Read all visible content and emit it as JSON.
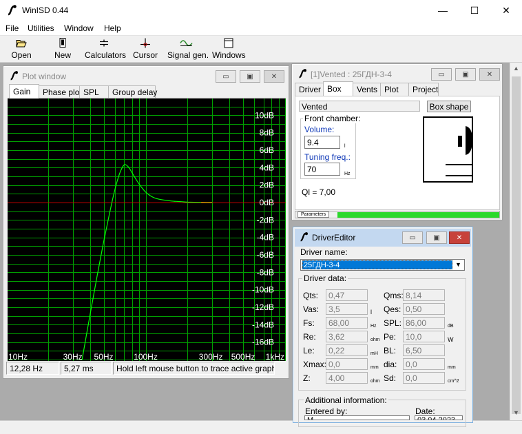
{
  "app": {
    "title": "WinISD 0.44",
    "controls": {
      "minimize": "—",
      "maximize": "☐",
      "close": "✕"
    }
  },
  "menu": [
    "File",
    "Utilities",
    "Window",
    "Help"
  ],
  "toolbar": {
    "open": "Open",
    "new": "New",
    "calculators": "Calculators",
    "cursor": "Cursor",
    "signal_gen": "Signal gen.",
    "windows": "Windows"
  },
  "plot_window": {
    "title": "Plot window",
    "tabs": [
      "Gain",
      "Phase plot",
      "SPL",
      "Group delay"
    ],
    "selected_tab": "Gain",
    "status": {
      "frequency": "12,28 Hz",
      "time": "5,27 ms",
      "hint": "Hold left mouse button to trace active graph"
    }
  },
  "chart_data": {
    "type": "line",
    "title": "",
    "xlabel": "",
    "ylabel": "",
    "x_scale": "log",
    "xlim": [
      10,
      1000
    ],
    "ylim": [
      -18,
      12
    ],
    "x_ticks": [
      {
        "value": 10,
        "label": "10Hz"
      },
      {
        "value": 30,
        "label": "30Hz"
      },
      {
        "value": 50,
        "label": "50Hz"
      },
      {
        "value": 100,
        "label": "100Hz"
      },
      {
        "value": 300,
        "label": "300Hz"
      },
      {
        "value": 500,
        "label": "500Hz"
      },
      {
        "value": 1000,
        "label": "1kHz"
      }
    ],
    "y_ticks": [
      {
        "value": 10,
        "label": "10dB"
      },
      {
        "value": 8,
        "label": "8dB"
      },
      {
        "value": 6,
        "label": "6dB"
      },
      {
        "value": 4,
        "label": "4dB"
      },
      {
        "value": 2,
        "label": "2dB"
      },
      {
        "value": 0,
        "label": "0dB"
      },
      {
        "value": -2,
        "label": "-2dB"
      },
      {
        "value": -4,
        "label": "-4dB"
      },
      {
        "value": -6,
        "label": "-6dB"
      },
      {
        "value": -8,
        "label": "-8dB"
      },
      {
        "value": -10,
        "label": "-10dB"
      },
      {
        "value": -12,
        "label": "-12dB"
      },
      {
        "value": -14,
        "label": "-14dB"
      },
      {
        "value": -16,
        "label": "-16dB"
      }
    ],
    "grid": true,
    "reference_line": 0,
    "colors": {
      "background": "#000000",
      "grid": "#00a000",
      "curve": "#00ff00",
      "curve_tail": "#c8c800",
      "reference": "#cc0000"
    },
    "series": [
      {
        "x": [
          35,
          40,
          45,
          50,
          55,
          60,
          65,
          70,
          75,
          80,
          85,
          90,
          95,
          100,
          110,
          120,
          140,
          160,
          180,
          200,
          250,
          300
        ],
        "y": [
          -18,
          -12.8,
          -8.3,
          -4.5,
          -1.3,
          1.4,
          3.3,
          4.3,
          4.1,
          3.4,
          2.7,
          2.1,
          1.6,
          1.2,
          0.7,
          0.45,
          0.25,
          0.15,
          0.1,
          0.05,
          0.02,
          0.0
        ]
      }
    ]
  },
  "box_window": {
    "title": "[1]Vented : 25ГДН-3-4",
    "tabs": [
      "Driver",
      "Box",
      "Vents",
      "Plot",
      "Project"
    ],
    "selected_tab": "Box",
    "box_type": "Vented",
    "box_shape_button": "Box shape",
    "front_chamber_label": "Front chamber:",
    "volume_label": "Volume:",
    "volume_value": "9.4",
    "volume_unit": "l",
    "tuning_label": "Tuning freq.:",
    "tuning_value": "70",
    "tuning_unit": "Hz",
    "ql": "Ql = 7,00",
    "parameters_tab": "Parameters"
  },
  "driver_editor": {
    "title": "DriverEditor",
    "driver_name_label": "Driver name:",
    "driver_name": "25ГДН-3-4",
    "driver_data_label": "Driver data:",
    "params": [
      {
        "label": "Qts:",
        "value": "0,47",
        "unit": ""
      },
      {
        "label": "Qms:",
        "value": "8,14",
        "unit": ""
      },
      {
        "label": "Vas:",
        "value": "3,5",
        "unit": "l"
      },
      {
        "label": "Qes:",
        "value": "0,50",
        "unit": ""
      },
      {
        "label": "Fs:",
        "value": "68,00",
        "unit": "Hz"
      },
      {
        "label": "SPL:",
        "value": "86,00",
        "unit": "dB"
      },
      {
        "label": "Re:",
        "value": "3,62",
        "unit": "ohm"
      },
      {
        "label": "Pe:",
        "value": "10,0",
        "unit": "W"
      },
      {
        "label": "Le:",
        "value": "0,22",
        "unit": "mH"
      },
      {
        "label": "BL:",
        "value": "6,50",
        "unit": ""
      },
      {
        "label": "Xmax:",
        "value": "0,0",
        "unit": "mm"
      },
      {
        "label": "dia:",
        "value": "0,0",
        "unit": "mm"
      },
      {
        "label": "Z:",
        "value": "4,00",
        "unit": "ohm"
      },
      {
        "label": "Sd:",
        "value": "0,0",
        "unit": "cm^2"
      }
    ],
    "additional_label": "Additional information:",
    "entered_by_label": "Entered by:",
    "entered_by_value": "M",
    "date_label": "Date:",
    "date_value": "03.04.2023"
  }
}
